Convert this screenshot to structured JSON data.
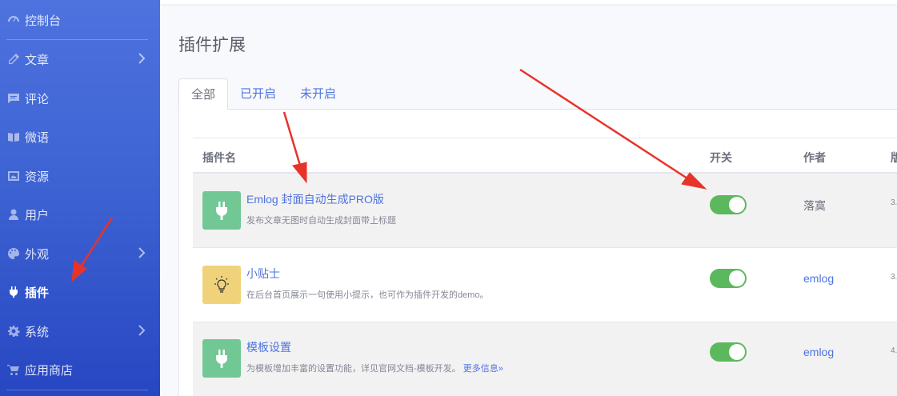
{
  "sidebar": {
    "items": [
      {
        "label": "控制台",
        "icon": "gauge-icon"
      },
      {
        "label": "文章",
        "icon": "pencil-icon"
      },
      {
        "label": "评论",
        "icon": "comment-icon"
      },
      {
        "label": "微语",
        "icon": "sticky-note-icon"
      },
      {
        "label": "资源",
        "icon": "image-icon"
      },
      {
        "label": "用户",
        "icon": "user-icon"
      },
      {
        "label": "外观",
        "icon": "palette-icon"
      },
      {
        "label": "插件",
        "icon": "plug-icon"
      },
      {
        "label": "系统",
        "icon": "gear-icon"
      },
      {
        "label": "应用商店",
        "icon": "cart-icon"
      }
    ]
  },
  "main": {
    "title": "插件扩展",
    "tabs": [
      "全部",
      "已开启",
      "未开启"
    ],
    "active_tab": "全部",
    "table": {
      "headers": [
        "插件名",
        "开关",
        "作者",
        "版"
      ],
      "rows": [
        {
          "name": "Emlog 封面自动生成PRO版",
          "desc": "发布文章无图时自动生成封面带上标题",
          "more": "",
          "enabled": true,
          "author": "落寞",
          "version": "3."
        },
        {
          "name": "小贴士",
          "desc": "在后台首页展示一句使用小提示，也可作为插件开发的demo。",
          "more": "",
          "enabled": true,
          "author": "emlog",
          "version": "3."
        },
        {
          "name": "模板设置",
          "desc": "为模板增加丰富的设置功能，详见官网文档-模板开发。",
          "more": "更多信息»",
          "enabled": true,
          "author": "emlog",
          "version": "4."
        }
      ]
    }
  },
  "colors": {
    "sidebar_top": "#4e73df",
    "sidebar_bottom": "#2746c2",
    "link": "#4e73df",
    "toggle_on": "#5cb85c",
    "annotation_arrow": "#e8332a"
  }
}
